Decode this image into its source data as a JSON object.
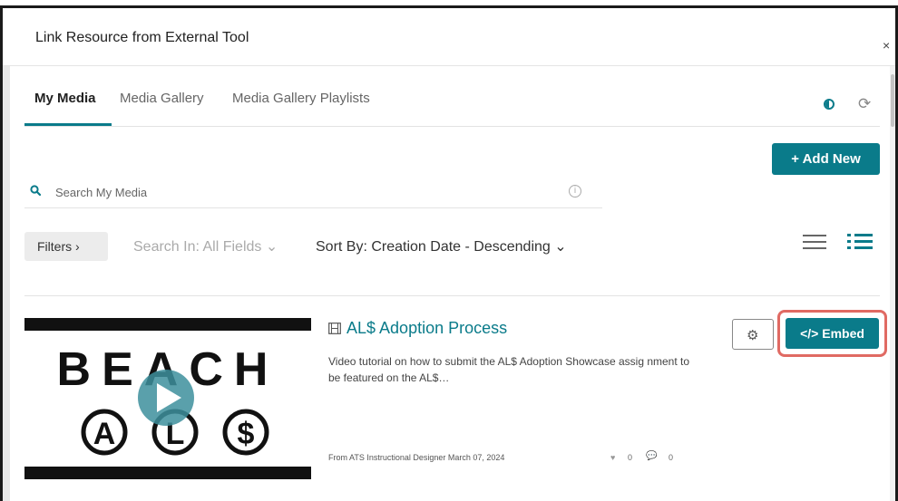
{
  "modal": {
    "title": "Link Resource from External Tool",
    "close_label": "×"
  },
  "tabs": [
    {
      "label": "My Media",
      "active": true
    },
    {
      "label": "Media Gallery",
      "active": false
    },
    {
      "label": "Media Gallery Playlists",
      "active": false
    }
  ],
  "toolbar": {
    "add_new_label": "+ Add New",
    "contrast_icon": "contrast-icon",
    "refresh_icon": "refresh-icon"
  },
  "search": {
    "placeholder": "Search My Media",
    "value": ""
  },
  "filters": {
    "filters_label": "Filters ›",
    "search_in_label": "Search In: All Fields ⌄",
    "sort_by_label": "Sort By: Creation Date - Descending ⌄"
  },
  "entry": {
    "title": "AL$ Adoption Process",
    "description": "Video tutorial on how to submit the AL$ Adoption Showcase assig nment to be featured on the AL$…",
    "meta": "From ATS Instructional Designer March 07, 2024",
    "likes": "0",
    "comments": "0",
    "embed_label": "</> Embed",
    "thumbnail_text_top": "BEACH",
    "thumbnail_text_bottom": "AL$"
  },
  "colors": {
    "accent": "#0a7b8a",
    "highlight": "#e06a63"
  }
}
